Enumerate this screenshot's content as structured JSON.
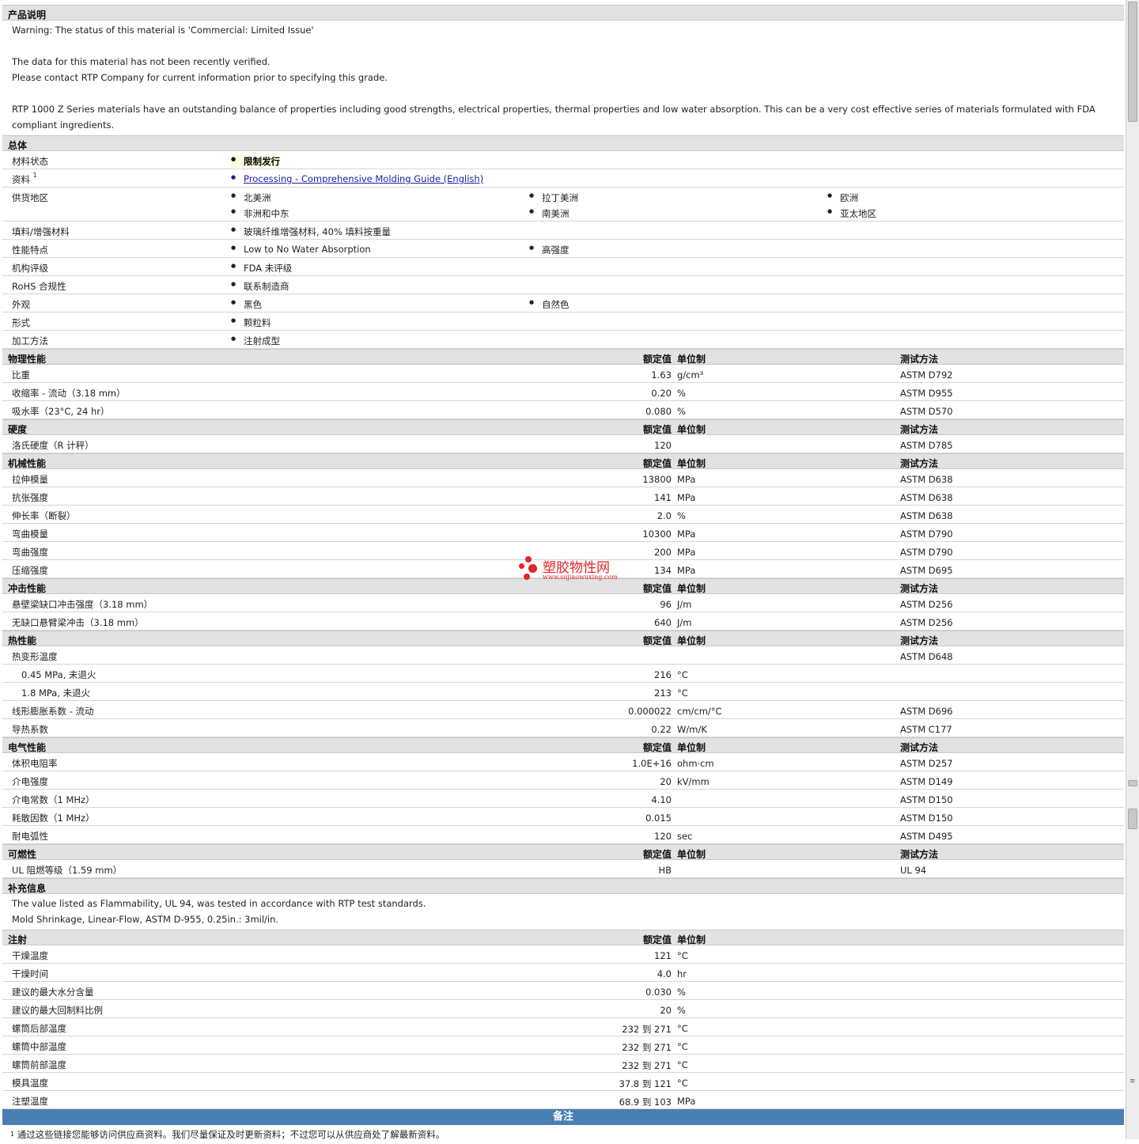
{
  "description": {
    "title": "产品说明",
    "lines": [
      "Warning: The status of this material is 'Commercial: Limited Issue'",
      "",
      "The data for this material has not been recently verified.",
      "Please contact RTP Company for current information prior to specifying this grade.",
      "",
      "RTP 1000 Z Series materials have an outstanding balance of properties including good strengths, electrical properties, thermal properties and low water absorption. This can be a very cost effective series of materials formulated with FDA compliant ingredients."
    ]
  },
  "general": {
    "title": "总体",
    "rows": [
      {
        "label": "材料状态",
        "sup": "",
        "items": [
          "限制发行"
        ],
        "style": "strong"
      },
      {
        "label": "资料",
        "sup": "1",
        "items": [
          "Processing - Comprehensive Molding Guide (English)"
        ],
        "style": "link"
      },
      {
        "label": "供货地区",
        "sup": "",
        "items": [
          "北美洲",
          "拉丁美洲",
          "欧洲",
          "非洲和中东",
          "南美洲",
          "亚太地区"
        ],
        "style": "grid"
      },
      {
        "label": "填料/增强材料",
        "sup": "",
        "items": [
          "玻璃纤维增强材料, 40% 填料按重量"
        ],
        "style": ""
      },
      {
        "label": "性能特点",
        "sup": "",
        "items": [
          "Low to No Water Absorption",
          "高强度"
        ],
        "style": ""
      },
      {
        "label": "机构评级",
        "sup": "",
        "items": [
          "FDA 未评级"
        ],
        "style": ""
      },
      {
        "label": "RoHS 合规性",
        "sup": "",
        "items": [
          "联系制造商"
        ],
        "style": ""
      },
      {
        "label": "外观",
        "sup": "",
        "items": [
          "黑色",
          "自然色"
        ],
        "style": ""
      },
      {
        "label": "形式",
        "sup": "",
        "items": [
          "颗粒料"
        ],
        "style": ""
      },
      {
        "label": "加工方法",
        "sup": "",
        "items": [
          "注射成型"
        ],
        "style": ""
      }
    ]
  },
  "columns": {
    "value": "额定值",
    "unit": "单位制",
    "method": "测试方法"
  },
  "sections": [
    {
      "title": "物理性能",
      "method_col": true,
      "rows": [
        {
          "label": "比重",
          "value": "1.63",
          "unit": "g/cm³",
          "method": "ASTM D792"
        },
        {
          "label": "收缩率  - 流动（3.18 mm）",
          "value": "0.20",
          "unit": "%",
          "method": "ASTM D955"
        },
        {
          "label": "吸水率（23°C, 24 hr）",
          "value": "0.080",
          "unit": "%",
          "method": "ASTM D570"
        }
      ]
    },
    {
      "title": "硬度",
      "method_col": true,
      "rows": [
        {
          "label": "洛氏硬度（R 计秤）",
          "value": "120",
          "unit": "",
          "method": "ASTM D785"
        }
      ]
    },
    {
      "title": "机械性能",
      "method_col": true,
      "rows": [
        {
          "label": "拉伸模量",
          "value": "13800",
          "unit": "MPa",
          "method": "ASTM D638"
        },
        {
          "label": "抗张强度",
          "value": "141",
          "unit": "MPa",
          "method": "ASTM D638"
        },
        {
          "label": "伸长率（断裂）",
          "value": "2.0",
          "unit": "%",
          "method": "ASTM D638"
        },
        {
          "label": "弯曲模量",
          "value": "10300",
          "unit": "MPa",
          "method": "ASTM D790"
        },
        {
          "label": "弯曲强度",
          "value": "200",
          "unit": "MPa",
          "method": "ASTM D790"
        },
        {
          "label": "压缩强度",
          "value": "134",
          "unit": "MPa",
          "method": "ASTM D695"
        }
      ]
    },
    {
      "title": "冲击性能",
      "method_col": true,
      "rows": [
        {
          "label": "悬壁梁缺口冲击强度（3.18 mm）",
          "value": "96",
          "unit": "J/m",
          "method": "ASTM D256"
        },
        {
          "label": "无缺口悬臂梁冲击（3.18 mm）",
          "value": "640",
          "unit": "J/m",
          "method": "ASTM D256"
        }
      ]
    },
    {
      "title": "热性能",
      "method_col": true,
      "rows": [
        {
          "label": "热变形温度",
          "value": "",
          "unit": "",
          "method": "ASTM D648"
        },
        {
          "label": "0.45 MPa, 未退火",
          "value": "216",
          "unit": "°C",
          "method": "",
          "sub": true
        },
        {
          "label": "1.8 MPa, 未退火",
          "value": "213",
          "unit": "°C",
          "method": "",
          "sub": true
        },
        {
          "label": "线形膨胀系数  - 流动",
          "value": "0.000022",
          "unit": "cm/cm/°C",
          "method": "ASTM D696"
        },
        {
          "label": "导热系数",
          "value": "0.22",
          "unit": "W/m/K",
          "method": "ASTM C177"
        }
      ]
    },
    {
      "title": "电气性能",
      "method_col": true,
      "rows": [
        {
          "label": "体积电阻率",
          "value": "1.0E+16",
          "unit": "ohm·cm",
          "method": "ASTM D257"
        },
        {
          "label": "介电强度",
          "value": "20",
          "unit": "kV/mm",
          "method": "ASTM D149"
        },
        {
          "label": "介电常数（1 MHz）",
          "value": "4.10",
          "unit": "",
          "method": "ASTM D150"
        },
        {
          "label": "耗散因数（1 MHz）",
          "value": "0.015",
          "unit": "",
          "method": "ASTM D150"
        },
        {
          "label": "耐电弧性",
          "value": "120",
          "unit": "sec",
          "method": "ASTM D495"
        }
      ]
    },
    {
      "title": "可燃性",
      "method_col": true,
      "rows": [
        {
          "label": "UL 阻燃等级（1.59 mm）",
          "value": "HB",
          "unit": "",
          "method": "UL 94"
        }
      ]
    }
  ],
  "supplement": {
    "title": "补充信息",
    "lines": [
      "The value listed as Flammability, UL 94, was tested in accordance with RTP test standards.",
      "Mold Shrinkage, Linear-Flow, ASTM D-955, 0.25in.: 3mil/in."
    ]
  },
  "injection": {
    "title": "注射",
    "rows": [
      {
        "label": "干燥温度",
        "value": "121",
        "unit": "°C"
      },
      {
        "label": "干燥时间",
        "value": "4.0",
        "unit": "hr"
      },
      {
        "label": "建议的最大水分含量",
        "value": "0.030",
        "unit": "%"
      },
      {
        "label": "建议的最大回制料比例",
        "value": "20",
        "unit": "%"
      },
      {
        "label": "螺筒后部温度",
        "value": "232 到  271",
        "unit": "°C"
      },
      {
        "label": "螺筒中部温度",
        "value": "232 到  271",
        "unit": "°C"
      },
      {
        "label": "螺筒前部温度",
        "value": "232 到  271",
        "unit": "°C"
      },
      {
        "label": "模具温度",
        "value": "37.8 到  121",
        "unit": "°C"
      },
      {
        "label": "注塑温度",
        "value": "68.9 到  103",
        "unit": "MPa"
      }
    ]
  },
  "notes": {
    "title": "备注",
    "footnote_num": "1",
    "footnote": "通过这些链接您能够访问供应商资料。我们尽量保证及时更新资料；不过您可以从供应商处了解最新资料。"
  },
  "watermark": {
    "cn": "塑胶物性网",
    "url": "www.sujiaowuxing.com"
  },
  "colors": {
    "section_bg": "#e2e2e2",
    "notes_bar": "#4a7fb4",
    "link": "#1c1ca8",
    "watermark": "#e4252c"
  }
}
